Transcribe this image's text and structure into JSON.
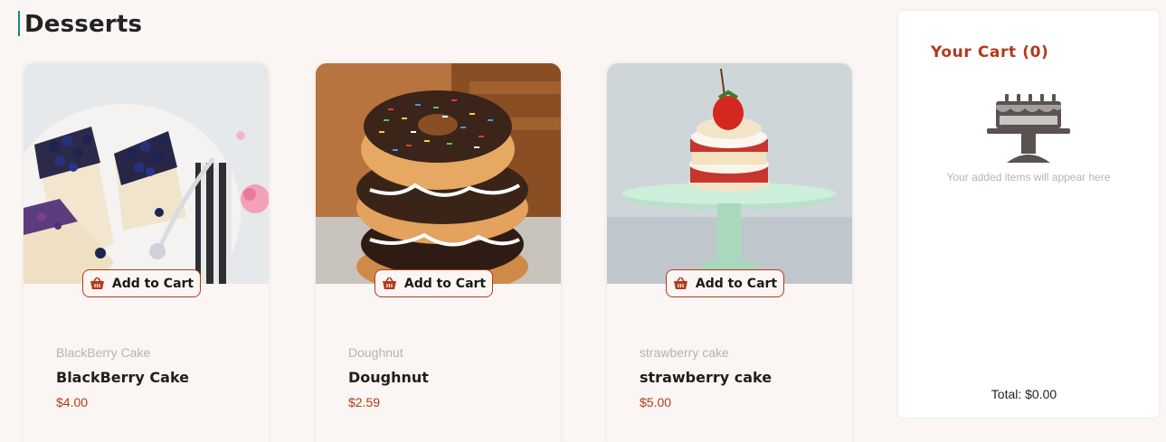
{
  "page": {
    "title": "Desserts"
  },
  "products": [
    {
      "image_icon": "blackberry-cheesecake-photo",
      "button_label": "Add to Cart",
      "category": "BlackBerry Cake",
      "name": "BlackBerry Cake",
      "price": "$4.00"
    },
    {
      "image_icon": "doughnut-stack-photo",
      "button_label": "Add to Cart",
      "category": "Doughnut",
      "name": "Doughnut",
      "price": "$2.59"
    },
    {
      "image_icon": "strawberry-shortcake-photo",
      "button_label": "Add to Cart",
      "category": "strawberry cake",
      "name": "strawberry cake",
      "price": "$5.00"
    }
  ],
  "cart": {
    "title": "Your Cart (0)",
    "empty_icon": "cake-icon",
    "empty_message": "Your added items will appear here",
    "total": "Total: $0.00"
  },
  "colors": {
    "accent": "#b5381b",
    "background": "#fbf6f3",
    "title_bar": "#0f8a8a"
  }
}
